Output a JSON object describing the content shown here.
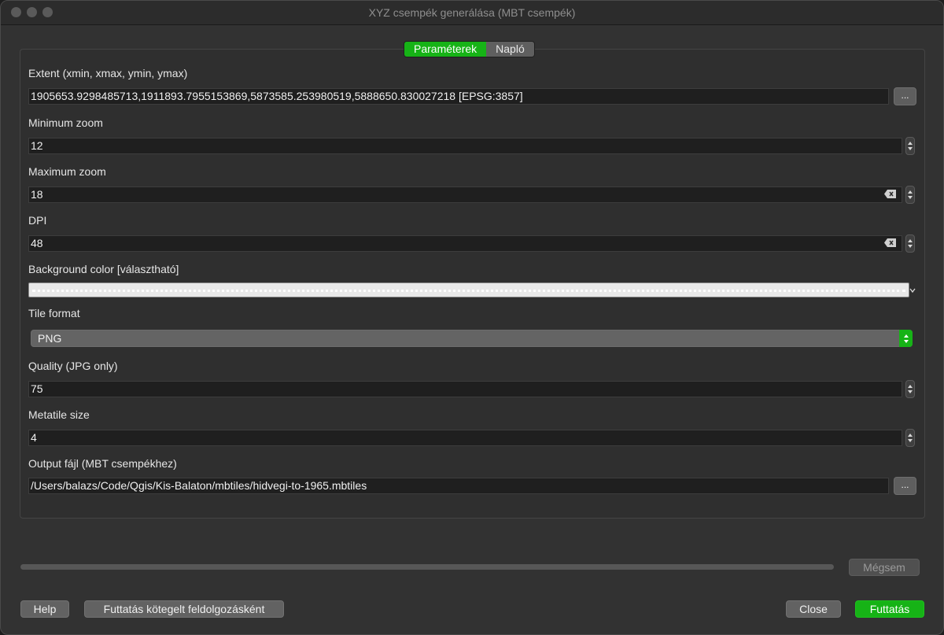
{
  "window": {
    "title": "XYZ csempék generálása (MBT csempék)"
  },
  "tabs": [
    {
      "label": "Paraméterek",
      "active": true
    },
    {
      "label": "Napló",
      "active": false
    }
  ],
  "params": {
    "extent": {
      "label": "Extent (xmin, xmax, ymin, ymax)",
      "value": "1905653.9298485713,1911893.7955153869,5873585.253980519,5888650.830027218 [EPSG:3857]",
      "button": "..."
    },
    "min_zoom": {
      "label": "Minimum zoom",
      "value": "12"
    },
    "max_zoom": {
      "label": "Maximum zoom",
      "value": "18"
    },
    "dpi": {
      "label": "DPI",
      "value": "48"
    },
    "background_color": {
      "label": "Background color [választható]"
    },
    "tile_format": {
      "label": "Tile format",
      "value": "PNG"
    },
    "quality": {
      "label": "Quality (JPG only)",
      "value": "75"
    },
    "metatile": {
      "label": "Metatile size",
      "value": "4"
    },
    "output": {
      "label": "Output fájl (MBT csempékhez)",
      "value": "/Users/balazs/Code/Qgis/Kis-Balaton/mbtiles/hidvegi-to-1965.mbtiles",
      "button": "..."
    }
  },
  "footer": {
    "cancel": "Mégsem",
    "help": "Help",
    "batch": "Futtatás kötegelt feldolgozásként",
    "close": "Close",
    "run": "Futtatás"
  },
  "colors": {
    "accent": "#16b316"
  }
}
